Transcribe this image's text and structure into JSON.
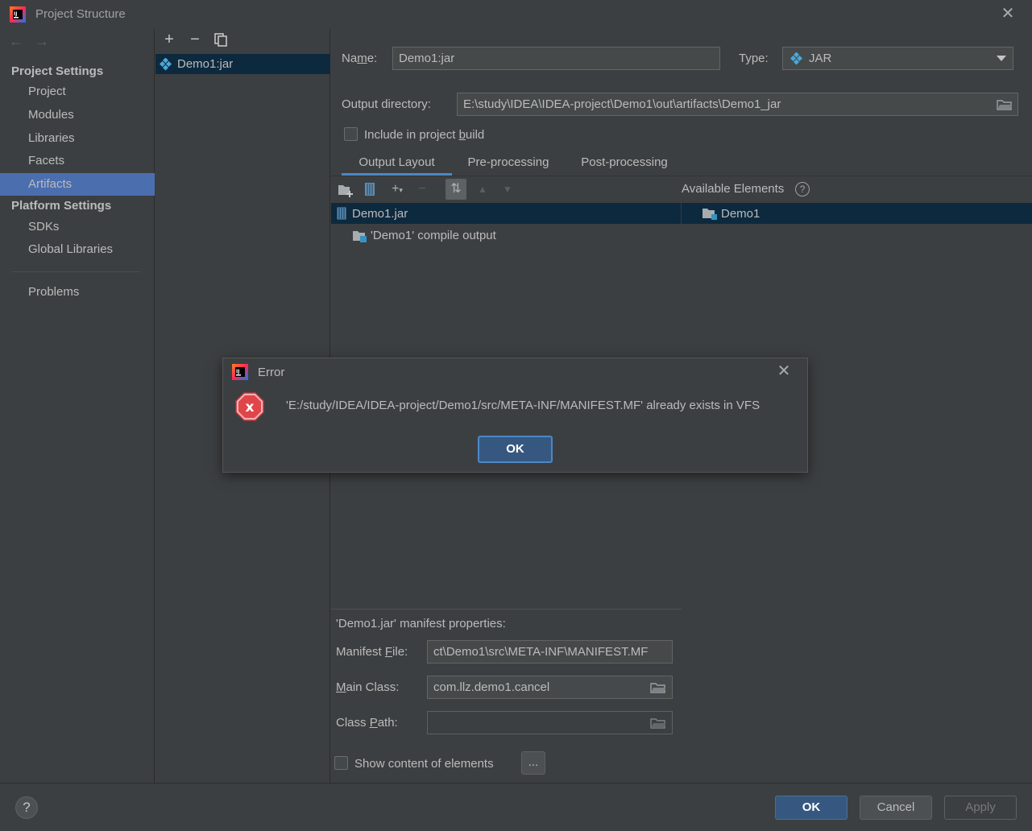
{
  "window": {
    "title": "Project Structure"
  },
  "nav": {
    "project_settings_header": "Project Settings",
    "platform_settings_header": "Platform Settings",
    "items": {
      "project": "Project",
      "modules": "Modules",
      "libraries": "Libraries",
      "facets": "Facets",
      "artifacts": "Artifacts",
      "sdks": "SDKs",
      "global_libraries": "Global Libraries",
      "problems": "Problems"
    },
    "selected": "Artifacts"
  },
  "artifacts": {
    "list": [
      "Demo1:jar"
    ]
  },
  "detail": {
    "name_label_pre": "Na",
    "name_label_u": "m",
    "name_label_post": "e:",
    "name_value": "Demo1:jar",
    "type_label": "Type:",
    "type_value": "JAR",
    "output_dir_label": "Output directory:",
    "output_dir_value": "E:\\study\\IDEA\\IDEA-project\\Demo1\\out\\artifacts\\Demo1_jar",
    "include_build_pre": "Include in project ",
    "include_build_u": "b",
    "include_build_post": "uild",
    "include_build_checked": false,
    "tabs": [
      "Output Layout",
      "Pre-processing",
      "Post-processing"
    ],
    "active_tab": "Output Layout",
    "available_elements_label": "Available Elements",
    "layout_tree": {
      "root": "Demo1.jar",
      "child": "'Demo1' compile output"
    },
    "available_tree": {
      "root": "Demo1"
    },
    "manifest": {
      "heading": "'Demo1.jar' manifest properties:",
      "file_label_pre": "Manifest ",
      "file_label_u": "F",
      "file_label_post": "ile:",
      "file_value": "ct\\Demo1\\src\\META-INF\\MANIFEST.MF",
      "main_class_label_u": "M",
      "main_class_label_post": "ain Class:",
      "main_class_value": "com.llz.demo1.cancel",
      "class_path_label_pre": "Class ",
      "class_path_label_u": "P",
      "class_path_label_post": "ath:",
      "class_path_value": ""
    },
    "show_content_label": "Show content of elements",
    "show_content_checked": false,
    "ellipsis_button": "..."
  },
  "footer": {
    "help": "?",
    "ok": "OK",
    "cancel": "Cancel",
    "apply": "Apply"
  },
  "error_dialog": {
    "title": "Error",
    "message": "'E:/study/IDEA/IDEA-project/Demo1/src/META-INF/MANIFEST.MF' already exists in VFS",
    "ok": "OK"
  },
  "colors": {
    "background": "#3c3f41",
    "selection": "#4b6eaf",
    "tree_selection": "#0d293e",
    "primary_button": "#365880",
    "focus_ring": "#4a88c7",
    "error_icon": "#e0454a"
  }
}
